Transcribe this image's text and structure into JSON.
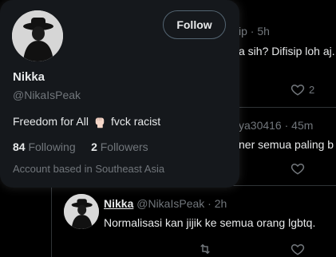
{
  "timeline": {
    "tweet1": {
      "meta": "ip · 5h",
      "text": "a sih? Difisip loh aj.",
      "like_count": "2"
    },
    "tweet2": {
      "meta": "ya30416 · 45m",
      "text": "ner semua paling b"
    },
    "tweet3": {
      "name": "Nikka",
      "handle": "@NikaIsPeak · 2h",
      "text": "Normalisasi kan jijik ke semua orang lgbtq."
    }
  },
  "hover_card": {
    "follow_label": "Follow",
    "name": "Nikka",
    "handle": "@NikaIsPeak",
    "bio_before": "Freedom for All",
    "bio_emoji": "raised-fist-emoji",
    "bio_after": "fvck racist",
    "following_count": "84",
    "following_label": "Following",
    "followers_count": "2",
    "followers_label": "Followers",
    "location_note": "Account based in Southeast Asia"
  },
  "colors": {
    "background": "#000000",
    "card": "#15181c",
    "text": "#e7e9ea",
    "muted": "#71767b",
    "border": "#2f3336"
  }
}
